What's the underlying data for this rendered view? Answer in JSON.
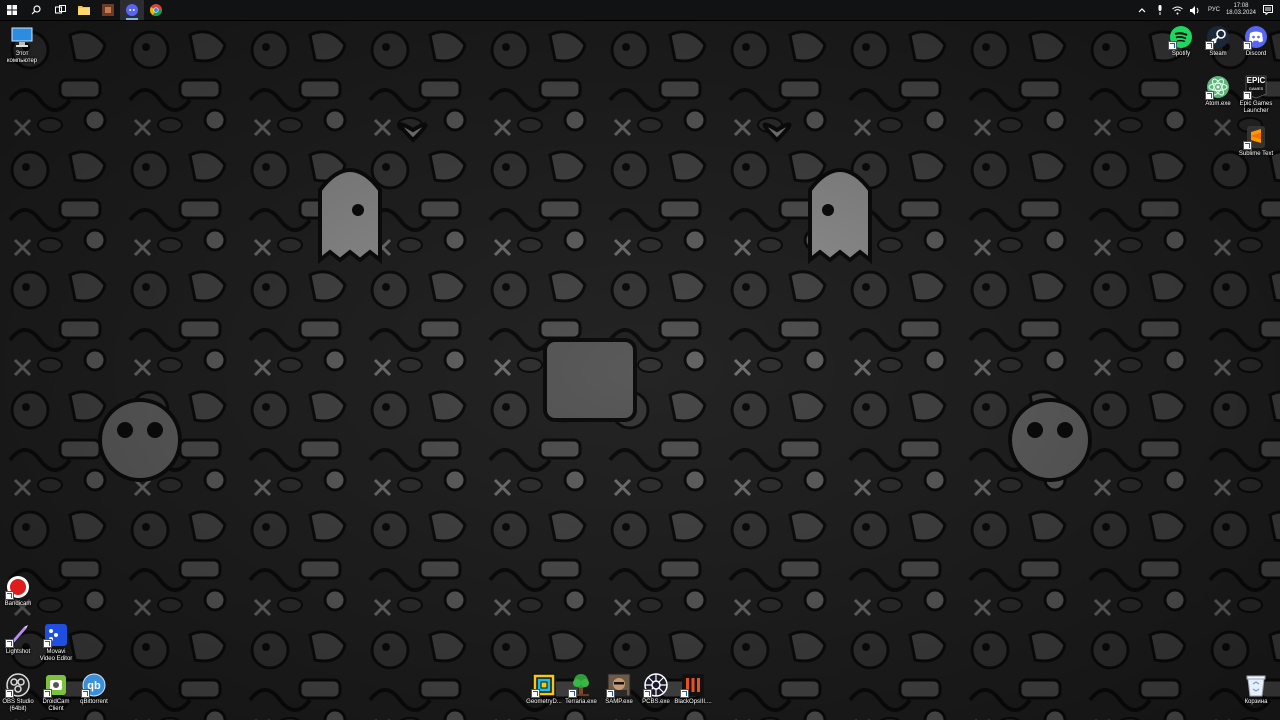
{
  "taskbar": {
    "pinned": [
      {
        "name": "windows-start-icon"
      },
      {
        "name": "search-icon"
      },
      {
        "name": "task-view-icon"
      },
      {
        "name": "file-explorer-icon"
      },
      {
        "name": "terraria-taskbar-icon"
      },
      {
        "name": "discord-taskbar-icon",
        "active": true
      },
      {
        "name": "chrome-icon"
      }
    ],
    "tray": {
      "language": "РУС",
      "time": "17:08",
      "date": "18.03.2024"
    }
  },
  "desktop_left": [
    {
      "name": "this-pc",
      "label": "Этот\nкомпьютер"
    },
    {
      "name": "bandicam",
      "label": "Bandicam"
    },
    {
      "name": "lightshot",
      "label": "Lightshot"
    },
    {
      "name": "movavi",
      "label": "Movavi\nVideo Editor"
    },
    {
      "name": "obs",
      "label": "OBS Studio\n(64bit)"
    },
    {
      "name": "droidcam",
      "label": "DroidCam\nClient"
    },
    {
      "name": "qbittorrent",
      "label": "qBittorrent"
    }
  ],
  "desktop_right": [
    {
      "name": "spotify",
      "label": "Spotify"
    },
    {
      "name": "steam",
      "label": "Steam"
    },
    {
      "name": "discord",
      "label": "Discord"
    },
    {
      "name": "atom",
      "label": "Atom.exe"
    },
    {
      "name": "epic",
      "label": "Epic Games\nLauncher",
      "logo": "EPIC",
      "logo_sub": "GAMES"
    },
    {
      "name": "sublime",
      "label": "Sublime Text"
    },
    {
      "name": "recycle-bin",
      "label": "Корзина"
    }
  ],
  "desktop_bottom": [
    {
      "name": "geometry-dash",
      "label": "GeometryD..."
    },
    {
      "name": "terraria",
      "label": "Terraria.exe"
    },
    {
      "name": "samp",
      "label": "SAMP.exe"
    },
    {
      "name": "pcbs",
      "label": "PCBS.exe"
    },
    {
      "name": "black-ops",
      "label": "BlackOpsIII...."
    }
  ],
  "colors": {
    "taskbar": "#111214",
    "accent": "#76b9ed",
    "spotify": "#1ed760",
    "discord": "#5865f2",
    "bandicam": "#e01b1b",
    "movavi": "#1e4fe0",
    "droidcam": "#7cc23b",
    "qbittorrent": "#3a8fd8"
  }
}
